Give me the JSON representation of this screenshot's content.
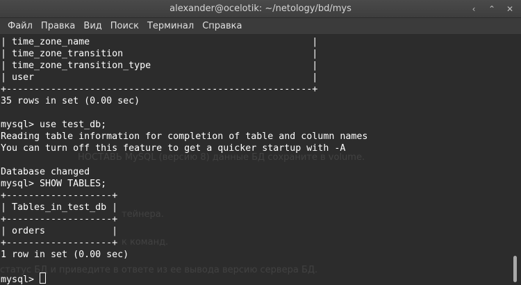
{
  "window": {
    "title": "alexander@ocelotik: ~/netology/bd/mys",
    "controls": {
      "minimize": "‹",
      "restore": "⌃",
      "close": "✕"
    }
  },
  "menu": [
    "Файл",
    "Правка",
    "Вид",
    "Поиск",
    "Терминал",
    "Справка"
  ],
  "terminal": {
    "lines": [
      "| time_zone_name                                        |",
      "| time_zone_transition                                  |",
      "| time_zone_transition_type                             |",
      "| user                                                  |",
      "+-------------------------------------------------------+",
      "35 rows in set (0.00 sec)",
      "",
      "mysql> use test_db;",
      "Reading table information for completion of table and column names",
      "You can turn off this feature to get a quicker startup with -A",
      "",
      "Database changed",
      "mysql> SHOW TABLES;",
      "+-------------------+",
      "| Tables_in_test_db |",
      "+-------------------+",
      "| orders            |",
      "+-------------------+",
      "1 row in set (0.00 sec)",
      "",
      "mysql> "
    ],
    "background_color": "#2c2c2c",
    "text_color": "#ffffff"
  },
  "background_ghost_text": [
    "НОСТАВЬ MySQL (версию 8) данные БД сохраните в volume.",
    "тейнера.",
    "к команд.",
    "статус БД и приведите в ответе из ее вывода версию сервера БД."
  ]
}
